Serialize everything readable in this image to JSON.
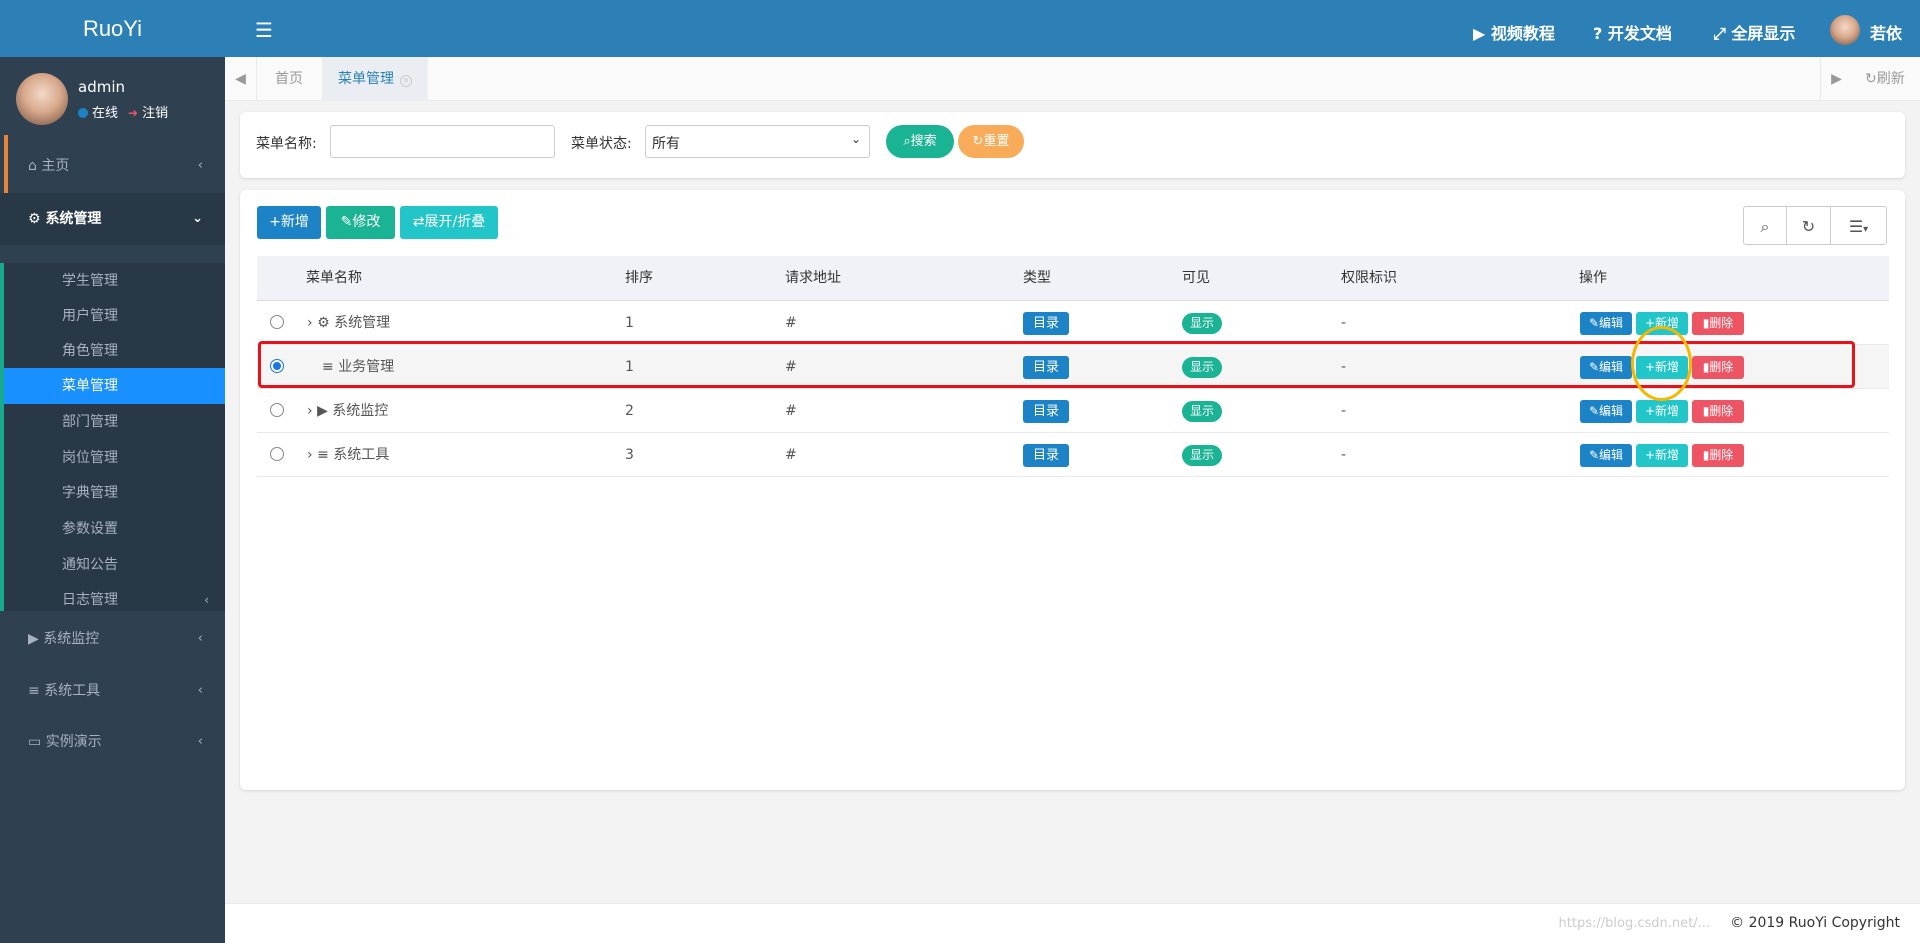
{
  "app": {
    "logo": "RuoYi"
  },
  "user": {
    "name": "admin",
    "online": "在线",
    "logout": "注销",
    "top_name": "若依"
  },
  "header": {
    "links": [
      {
        "icon": "video-icon",
        "label": "视频教程"
      },
      {
        "icon": "question-icon",
        "label": "开发文档"
      },
      {
        "icon": "fullscreen-icon",
        "label": "全屏显示"
      }
    ]
  },
  "sidebar": {
    "home": "主页",
    "system": "系统管理",
    "sub_items": [
      "学生管理",
      "用户管理",
      "角色管理",
      "菜单管理",
      "部门管理",
      "岗位管理",
      "字典管理",
      "参数设置",
      "通知公告",
      "日志管理"
    ],
    "active_sub": "菜单管理",
    "monitor": "系统监控",
    "tools": "系统工具",
    "demo": "实例演示"
  },
  "tabs": {
    "items": [
      "首页",
      "菜单管理"
    ],
    "active": "菜单管理",
    "refresh": "刷新"
  },
  "search": {
    "name_label": "菜单名称:",
    "name_value": "",
    "status_label": "菜单状态:",
    "status_value": "所有",
    "search_btn": "搜索",
    "reset_btn": "重置"
  },
  "toolbar": {
    "add": "新增",
    "edit": "修改",
    "expand": "展开/折叠"
  },
  "table": {
    "headers": [
      "菜单名称",
      "排序",
      "请求地址",
      "类型",
      "可见",
      "权限标识",
      "操作"
    ],
    "rows": [
      {
        "name": "系统管理",
        "icon": "gear-icon",
        "order": "1",
        "url": "#",
        "type": "目录",
        "visible": "显示",
        "perm": "-",
        "selected": false
      },
      {
        "name": "业务管理",
        "icon": "list-icon",
        "order": "1",
        "url": "#",
        "type": "目录",
        "visible": "显示",
        "perm": "-",
        "selected": true
      },
      {
        "name": "系统监控",
        "icon": "video-icon",
        "order": "2",
        "url": "#",
        "type": "目录",
        "visible": "显示",
        "perm": "-",
        "selected": false
      },
      {
        "name": "系统工具",
        "icon": "list-icon",
        "order": "3",
        "url": "#",
        "type": "目录",
        "visible": "显示",
        "perm": "-",
        "selected": false
      }
    ],
    "ops": {
      "edit": "编辑",
      "add": "新增",
      "del": "删除"
    }
  },
  "footer": {
    "copyright": "© 2019 RuoYi Copyright",
    "watermark": "https://blog.csdn.net/..."
  },
  "colors": {
    "header": "#2c80b6",
    "sidebar": "#2f4050",
    "active_menu": "#1890ff",
    "primary": "#1c84c6",
    "success": "#1ab394",
    "info": "#23c6c8",
    "danger": "#ed5565",
    "warning": "#f8ac59"
  }
}
